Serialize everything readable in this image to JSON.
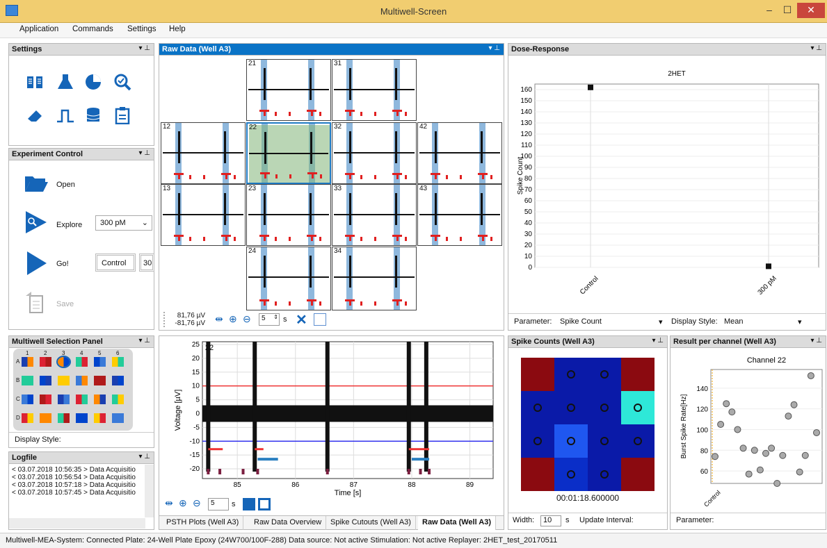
{
  "window": {
    "title": "Multiwell-Screen",
    "minimize": "–",
    "maximize": "☐",
    "close": "✕"
  },
  "menu": [
    "Application",
    "Commands",
    "Settings",
    "Help"
  ],
  "settings": {
    "title": "Settings",
    "icons": [
      "book-icon",
      "flask-icon",
      "pie-chart-icon",
      "zoom-check-icon",
      "eraser-icon",
      "pulse-icon",
      "database-icon",
      "clipboard-icon"
    ]
  },
  "experiment": {
    "title": "Experiment Control",
    "open": "Open",
    "explore": "Explore",
    "explore_value": "300 pM",
    "go": "Go!",
    "control": "Control",
    "next": "30",
    "save": "Save"
  },
  "multiwell": {
    "title": "Multiwell Selection Panel",
    "cols": [
      "1",
      "2",
      "3",
      "4",
      "5",
      "6"
    ],
    "rows": [
      "A",
      "B",
      "C",
      "D"
    ],
    "display_style": "Display Style:"
  },
  "logfile": {
    "title": "Logfile",
    "lines": [
      "< 03.07.2018 10:56:35 > Data Acquisitio",
      "< 03.07.2018 10:56:54 > Data Acquisitio",
      "< 03.07.2018 10:57:18 > Data Acquisitio",
      "< 03.07.2018 10:57:45 > Data Acquisitio"
    ]
  },
  "raw": {
    "title": "Raw Data (Well A3)",
    "channels": [
      "21",
      "31",
      "12",
      "22",
      "32",
      "42",
      "13",
      "23",
      "33",
      "43",
      "24",
      "34"
    ],
    "scale_top": "81,76 µV",
    "scale_bottom": "-81,76 µV",
    "window_value": "5",
    "unit": "s"
  },
  "plot": {
    "channel": "22",
    "ylabel": "Voltage [µV]",
    "xlabel": "Time [s]",
    "yticks": [
      "25",
      "20",
      "15",
      "10",
      "5",
      "0",
      "-5",
      "-10",
      "-15",
      "-20"
    ],
    "xticks": [
      "85",
      "86",
      "87",
      "88",
      "89"
    ],
    "window_value": "5",
    "unit": "s"
  },
  "tabs": [
    "PSTH Plots (Well A3)",
    "Raw Data Overview",
    "Spike Cutouts (Well A3)",
    "Raw Data (Well A3)"
  ],
  "dose": {
    "title": "Dose-Response",
    "parameter_label": "Parameter:",
    "parameter": "Spike Count",
    "display_label": "Display Style:",
    "display": "Mean"
  },
  "spike": {
    "title": "Spike Counts (Well A3)",
    "time": "00:01:18.600000",
    "width_label": "Width:",
    "width": "10",
    "unit": "s",
    "interval": "Update Interval:"
  },
  "result": {
    "title": "Result per channel (Well A3)",
    "parameter": "Parameter:"
  },
  "chart_data": [
    {
      "type": "scatter",
      "title": "2HET",
      "xlabel": "",
      "ylabel": "Spike Count",
      "categories": [
        "Control",
        "300 pM"
      ],
      "values": [
        162,
        1
      ],
      "ylim": [
        0,
        165
      ],
      "yticks": [
        0,
        10,
        20,
        30,
        40,
        50,
        60,
        70,
        80,
        90,
        100,
        110,
        120,
        130,
        140,
        150,
        160
      ],
      "grid": true
    },
    {
      "type": "scatter",
      "title": "Channel 22",
      "xlabel": "",
      "ylabel": "Burst Spike Rate[Hz]",
      "categories": [
        "Control"
      ],
      "values": [
        74,
        105,
        125,
        117,
        100,
        82,
        57,
        80,
        61,
        77,
        82,
        48,
        75,
        113,
        124,
        59,
        75,
        152,
        97
      ],
      "yticks": [
        60,
        80,
        100,
        120,
        140
      ],
      "ylim": [
        48,
        158
      ]
    }
  ],
  "status": "Multiwell-MEA-System: Connected  Plate: 24-Well Plate Epoxy (24W700/100F-288)  Data source: Not active  Stimulation: Not active  Replayer: 2HET_test_20170511"
}
